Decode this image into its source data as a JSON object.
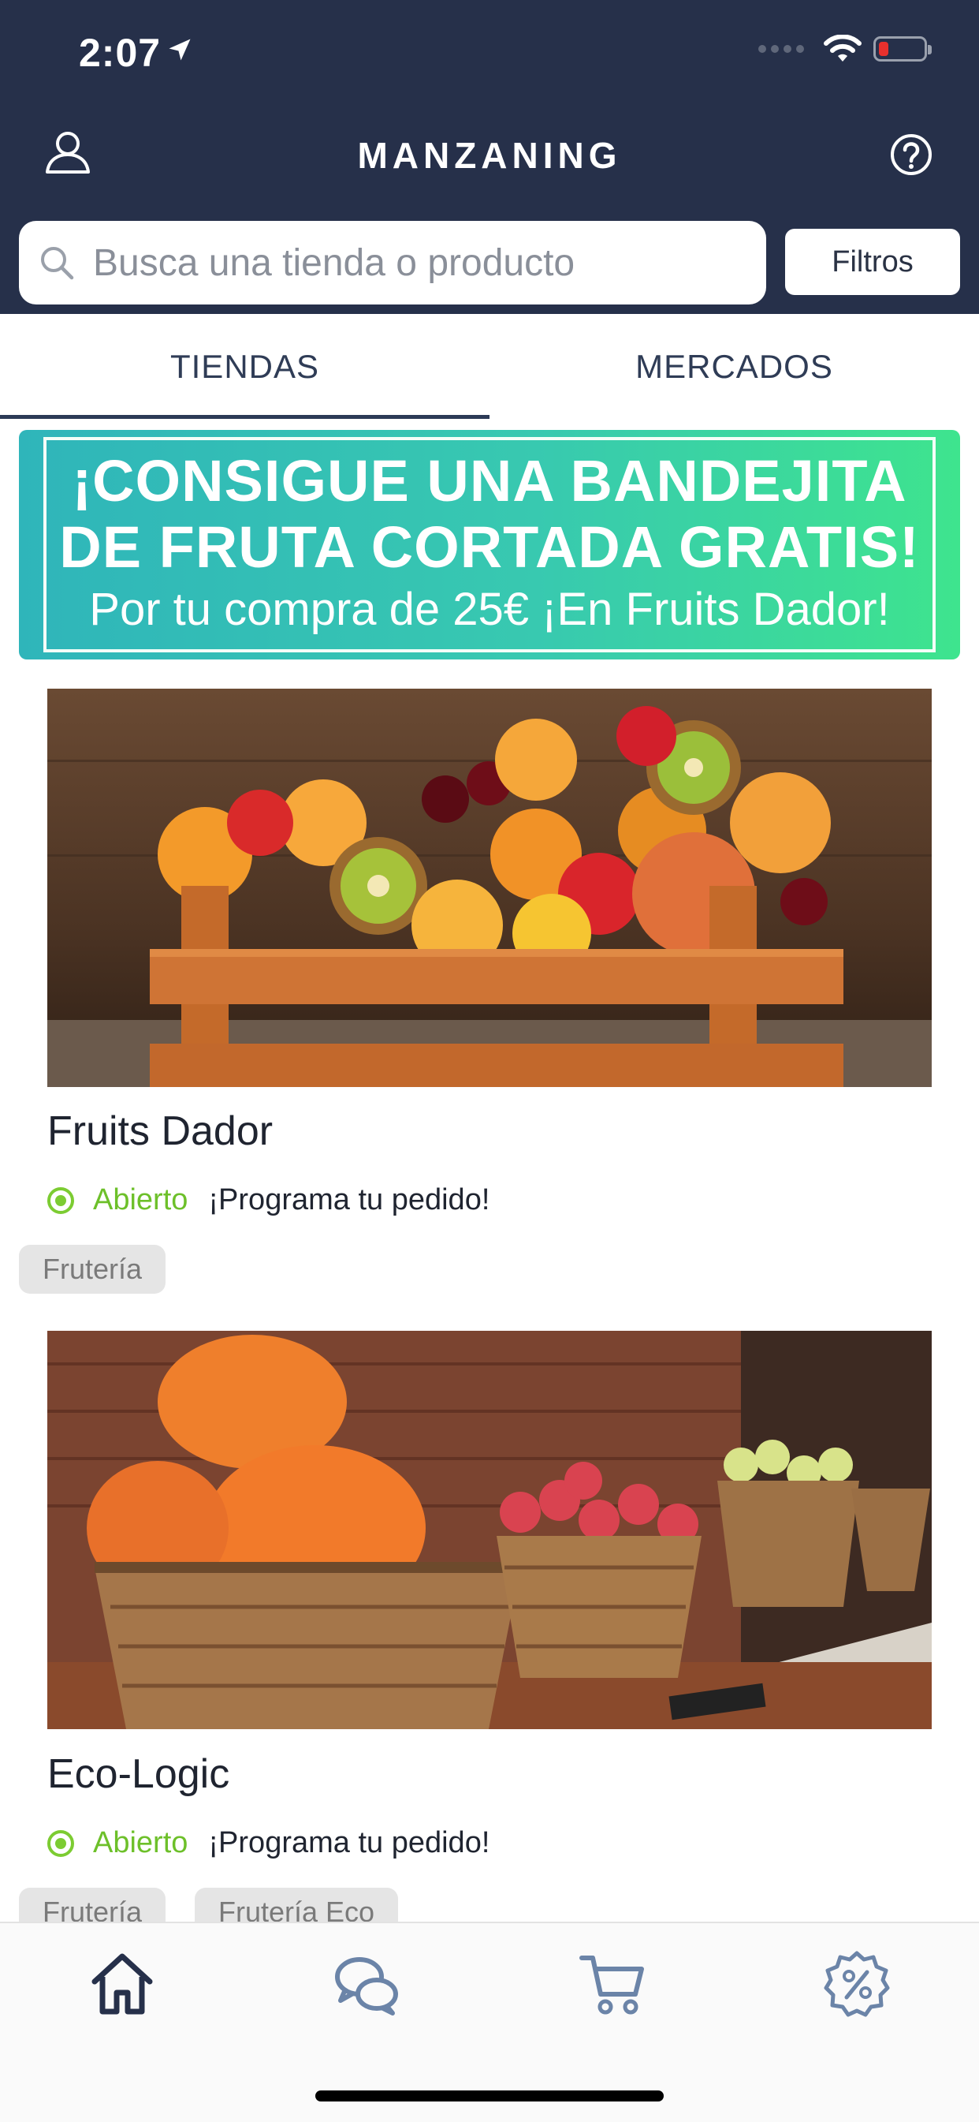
{
  "status_bar": {
    "time": "2:07"
  },
  "header": {
    "title": "MANZANING"
  },
  "search": {
    "placeholder": "Busca una tienda o producto",
    "filter_label": "Filtros"
  },
  "tabs": [
    {
      "label": "TIENDAS",
      "active": true
    },
    {
      "label": "MERCADOS",
      "active": false
    }
  ],
  "banner": {
    "line1": "¡CONSIGUE UNA BANDEJITA",
    "line2": "DE FRUTA CORTADA GRATIS!",
    "line3": "Por tu compra de 25€ ¡En Fruits Dador!"
  },
  "stores": [
    {
      "name": "Fruits Dador",
      "status": "Abierto",
      "schedule": "¡Programa tu pedido!",
      "tags": [
        "Frutería"
      ]
    },
    {
      "name": "Eco-Logic",
      "status": "Abierto",
      "schedule": "¡Programa tu pedido!",
      "tags": [
        "Frutería",
        "Frutería Eco"
      ]
    }
  ],
  "bottom_nav": [
    {
      "icon": "home-icon",
      "active": true
    },
    {
      "icon": "chat-icon",
      "active": false
    },
    {
      "icon": "cart-icon",
      "active": false
    },
    {
      "icon": "discount-icon",
      "active": false
    }
  ],
  "colors": {
    "header_bg": "#26304a",
    "open_green": "#6dc02a",
    "banner_start": "#2fb5ba",
    "banner_end": "#3ee48e"
  }
}
